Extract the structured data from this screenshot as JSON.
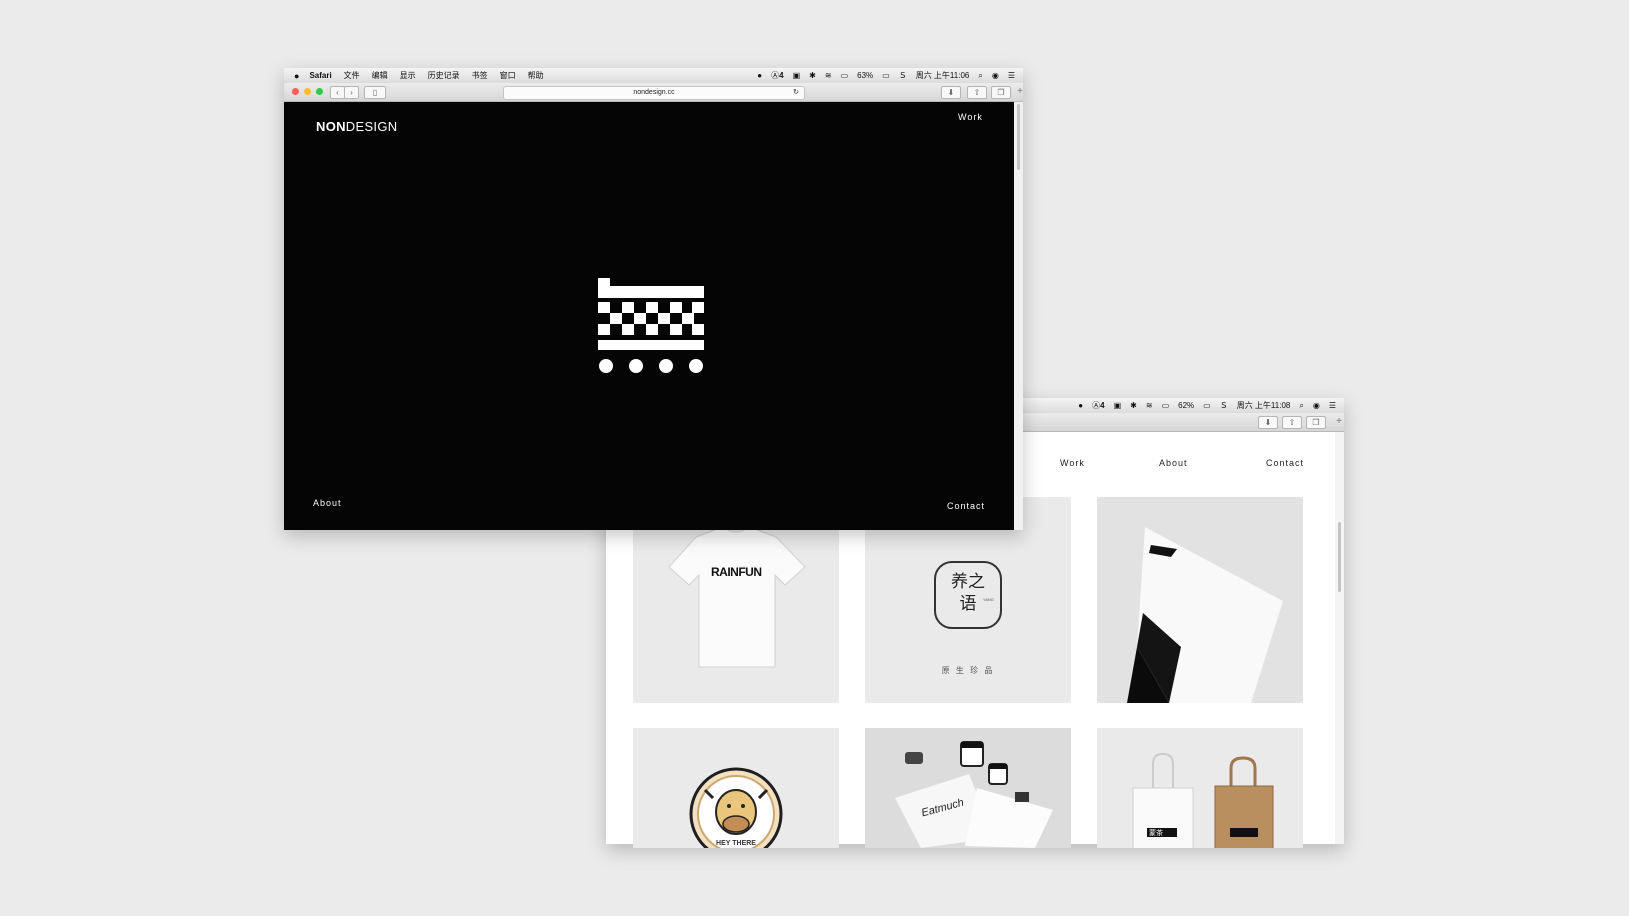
{
  "back_window": {
    "status": {
      "battery": "62%",
      "clock": "周六 上午11:08",
      "notification_count": "4"
    },
    "nav": {
      "work": "Work",
      "about": "About",
      "contact": "Contact"
    },
    "tiles": [
      {
        "name": "rainfun-tshirt",
        "text": "RAINFUN"
      },
      {
        "name": "yangzhiyu-logo",
        "text": "养之语",
        "sub": "YANG",
        "tagline": "原 生 珍 品"
      },
      {
        "name": "letterhead-mockup"
      },
      {
        "name": "cow-badge",
        "text": "HEY THERE"
      },
      {
        "name": "eatmuch-stationery",
        "text": "Eatmuch"
      },
      {
        "name": "tote-bags",
        "text": "蒙茶"
      }
    ]
  },
  "front_window": {
    "menubar": {
      "app": "Safari",
      "items": [
        "文件",
        "编辑",
        "显示",
        "历史记录",
        "书签",
        "窗口",
        "帮助"
      ]
    },
    "status": {
      "notification_count": "4",
      "battery": "63%",
      "clock": "周六 上午11:06"
    },
    "url": "nondesign.cc",
    "page": {
      "logo_bold": "NON",
      "logo_light": "DESIGN",
      "nav": {
        "work": "Work",
        "about": "About",
        "contact": "Contact"
      }
    }
  },
  "colors": {
    "desktop": "#ebebeb",
    "page_black": "#050505",
    "close": "#fc5f57",
    "minimize": "#fdbc2e",
    "zoom": "#33c748"
  }
}
